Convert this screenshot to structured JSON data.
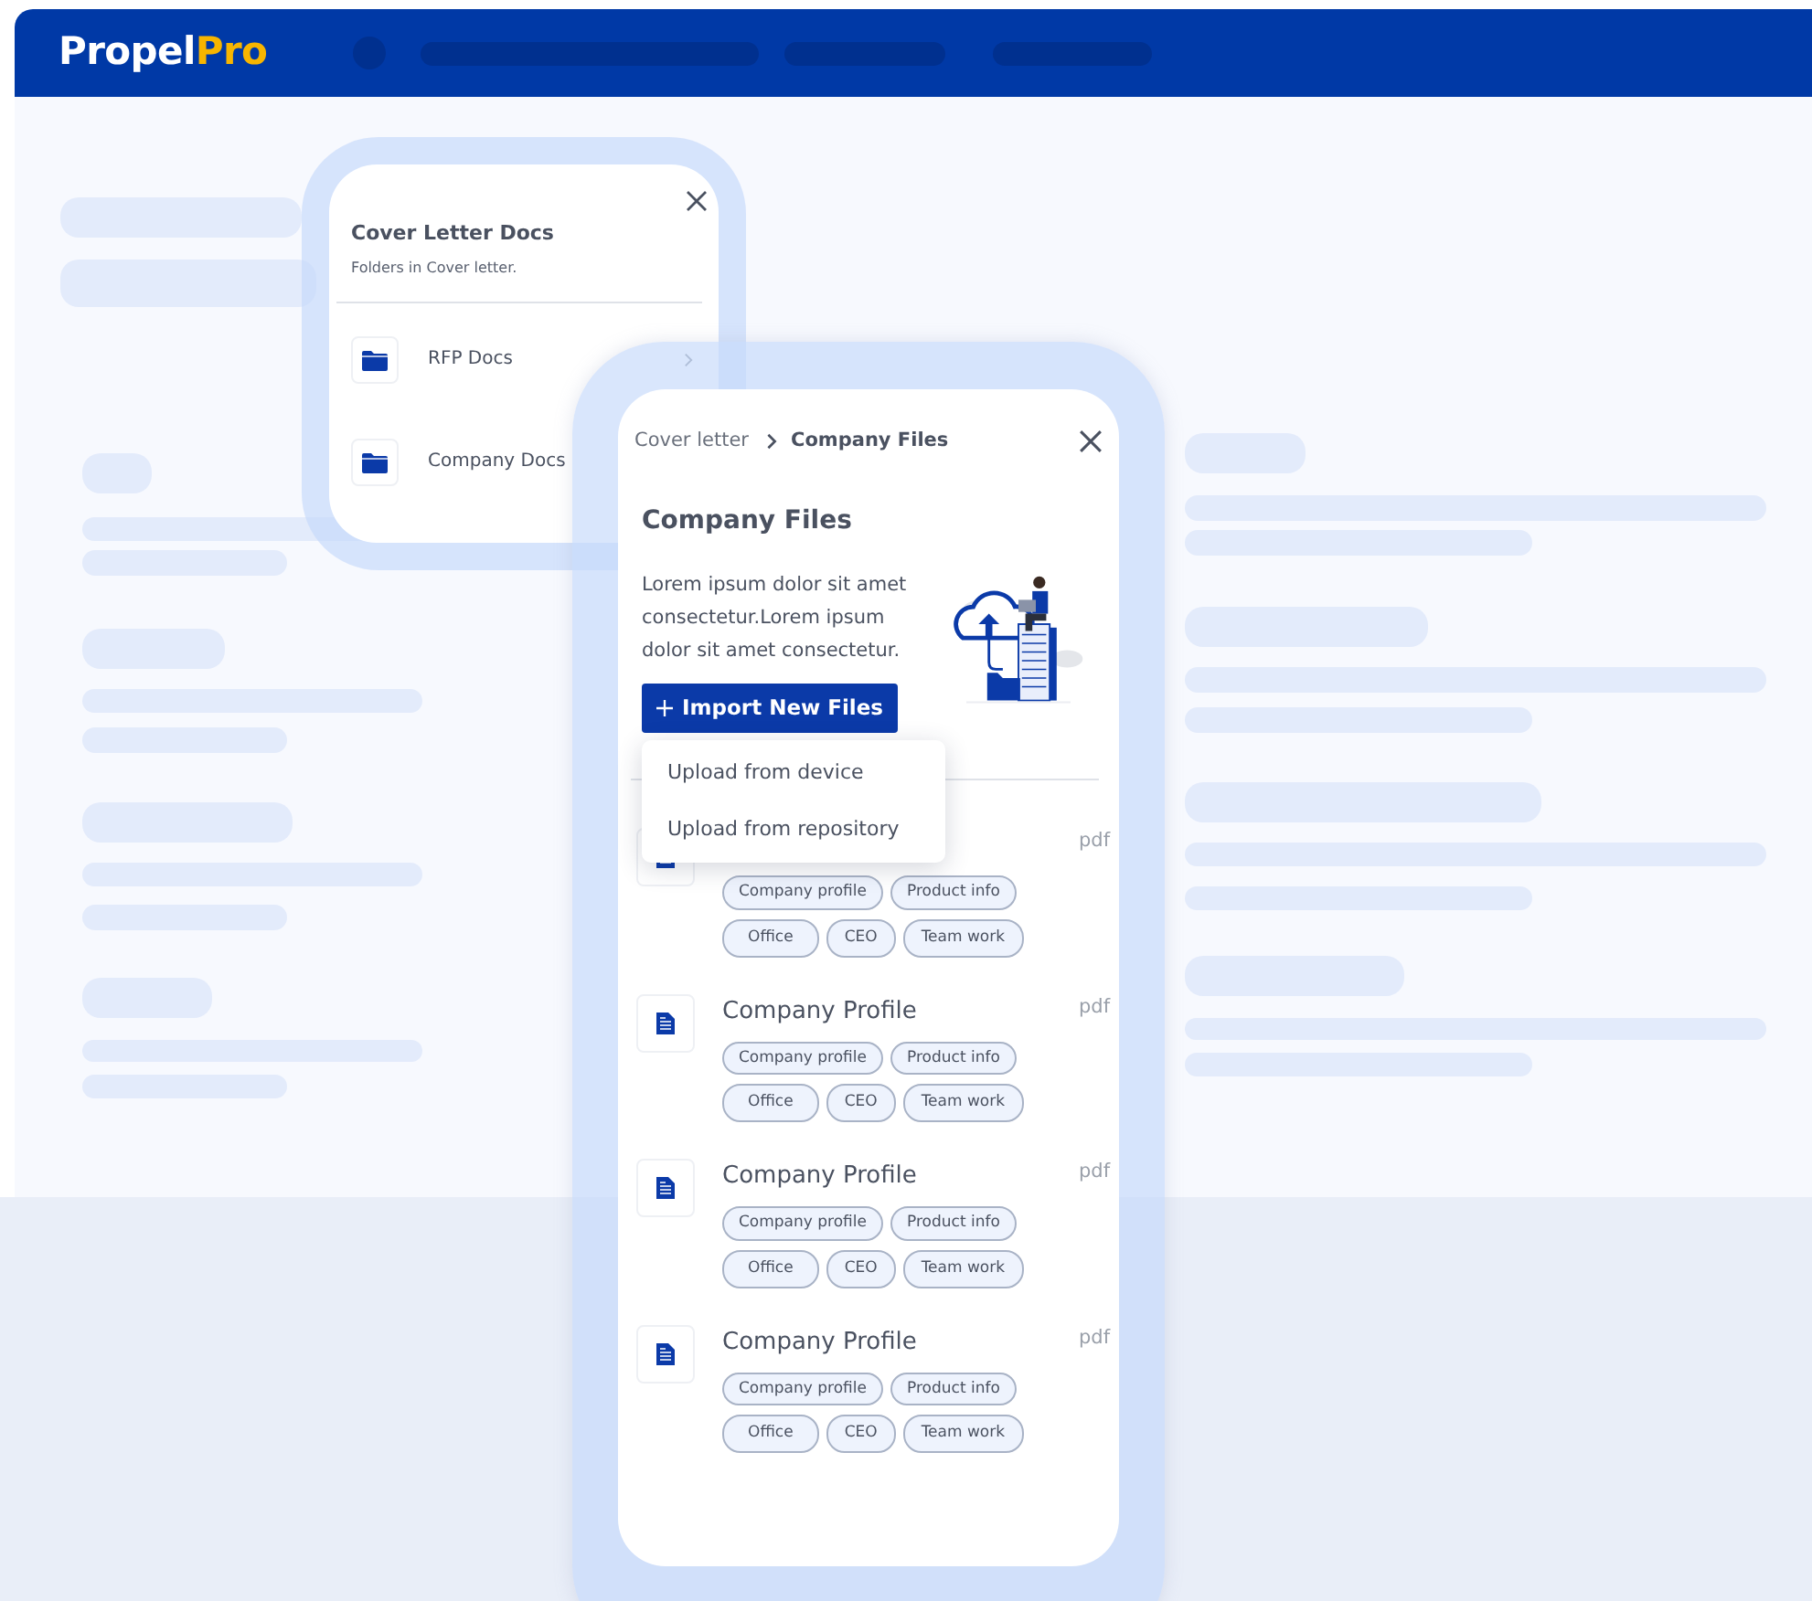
{
  "navbar": {
    "logo": {
      "primary": "Propel",
      "accent": "Pro"
    }
  },
  "folders_panel": {
    "title": "Cover Letter Docs",
    "subtitle": "Folders in Cover letter.",
    "items": [
      {
        "label": "RFP Docs",
        "chevron": true
      },
      {
        "label": "Company Docs",
        "chevron": false
      }
    ]
  },
  "files_panel": {
    "breadcrumb": [
      {
        "label": "Cover letter",
        "current": false
      },
      {
        "label": "Company Files",
        "current": true
      }
    ],
    "title": "Company Files",
    "description": "Lorem ipsum dolor sit amet consectetur.Lorem ipsum dolor sit amet consectetur.",
    "import_button": {
      "label": "Import New Files"
    },
    "import_menu": {
      "open": true,
      "items": [
        "Upload from device",
        "Upload from repository"
      ]
    },
    "files": [
      {
        "type": "pdf",
        "tags": [
          "Company profile",
          "Product info",
          "Office",
          "CEO",
          "Team work"
        ]
      },
      {
        "title": "Company Profile",
        "type": "pdf",
        "tags": [
          "Company profile",
          "Product info",
          "Office",
          "CEO",
          "Team work"
        ]
      },
      {
        "title": "Company Profile",
        "type": "pdf",
        "tags": [
          "Company profile",
          "Product info",
          "Office",
          "CEO",
          "Team work"
        ]
      },
      {
        "title": "Company Profile",
        "type": "pdf",
        "tags": [
          "Company profile",
          "Product info",
          "Office",
          "CEO",
          "Team work"
        ]
      }
    ]
  }
}
